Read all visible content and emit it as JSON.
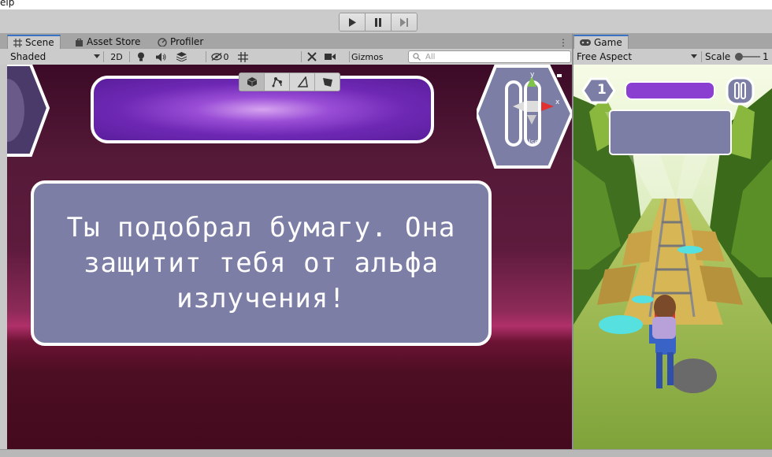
{
  "menu": {
    "partial_text": "elp"
  },
  "toolbar": {
    "play_icon": "play-icon",
    "pause_icon": "pause-icon",
    "step_icon": "step-icon"
  },
  "scene_tabs": [
    {
      "label": "Scene",
      "icon": "grid-icon"
    },
    {
      "label": "Asset Store",
      "icon": "shopping-bag-icon"
    },
    {
      "label": "Profiler",
      "icon": "profiler-icon"
    }
  ],
  "scene_controls": {
    "shading_mode": "Shaded",
    "toggle_2d": "2D",
    "hidden_count": "0",
    "gizmos_label": "Gizmos",
    "search_placeholder": "All"
  },
  "scene_tools": [
    "cube-icon",
    "graph-icon",
    "triangle-icon",
    "quad-icon"
  ],
  "orientation_gizmo": {
    "axis_y": "y",
    "axis_x": "x",
    "mode": "Iso"
  },
  "scene": {
    "message": "Ты подобрал бумагу. Она защитит тебя от альфа излучения!"
  },
  "game_tab": {
    "label": "Game",
    "icon": "gamepad-icon"
  },
  "game_controls": {
    "aspect": "Free Aspect",
    "scale_label": "Scale",
    "scale_value": "1"
  },
  "game": {
    "level_number": "1"
  },
  "colors": {
    "editor_bg": "#cbcbcb",
    "scene_bg": "#4c0e22",
    "panel": "#7c7ea6",
    "bar_purple": "#6e28b4",
    "active_tab": "#3a72c4"
  }
}
